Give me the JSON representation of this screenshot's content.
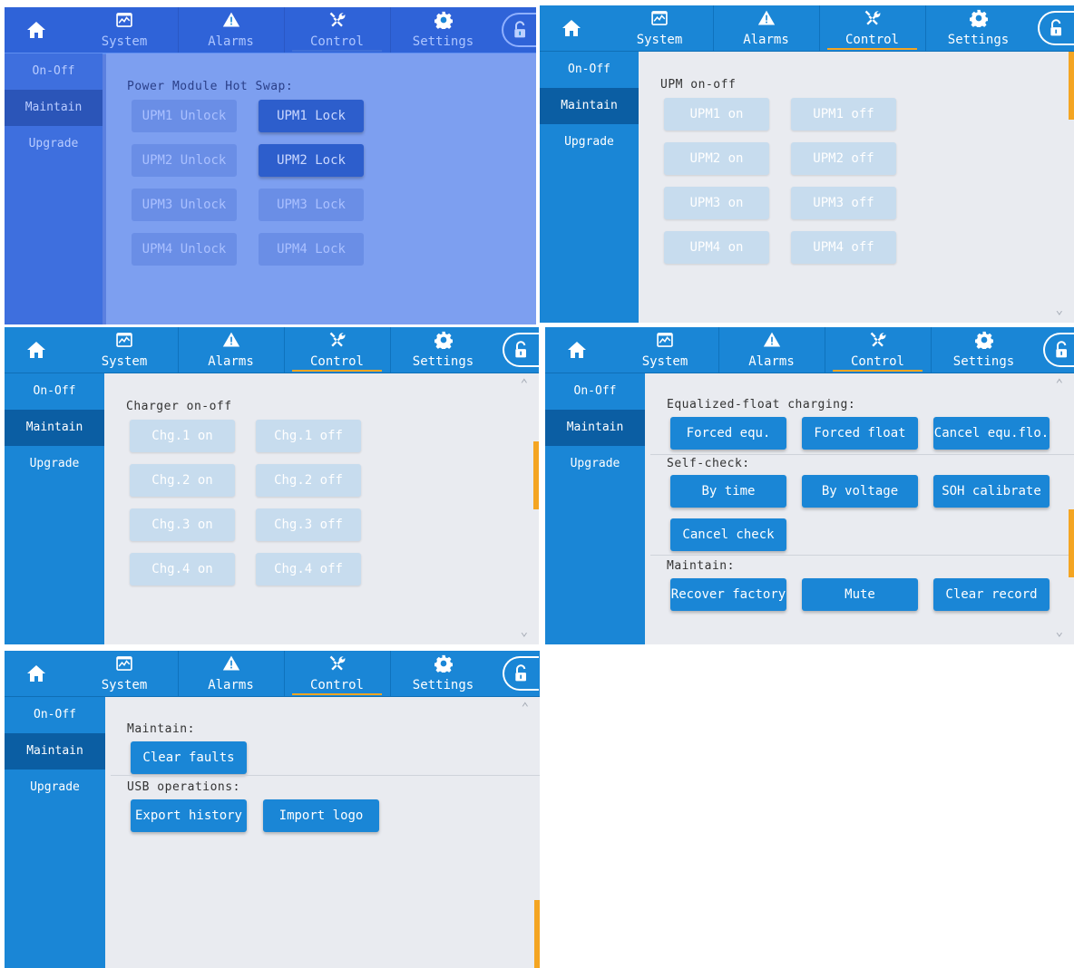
{
  "nav": {
    "tabs": [
      "System",
      "Alarms",
      "Control",
      "Settings"
    ],
    "active_tab": "Control",
    "home_icon": "home-icon",
    "lock_icon": "unlock-icon"
  },
  "sidebar": {
    "items": [
      "On-Off",
      "Maintain",
      "Upgrade"
    ],
    "active": "Maintain"
  },
  "panels": {
    "hot_swap": {
      "section": "Power Module Hot Swap:",
      "buttons": [
        "UPM1 Unlock",
        "UPM1 Lock",
        "UPM2 Unlock",
        "UPM2 Lock",
        "UPM3 Unlock",
        "UPM3 Lock",
        "UPM4 Unlock",
        "UPM4 Lock"
      ]
    },
    "upm": {
      "section": "UPM on-off",
      "buttons": [
        "UPM1 on",
        "UPM1 off",
        "UPM2 on",
        "UPM2 off",
        "UPM3 on",
        "UPM3 off",
        "UPM4 on",
        "UPM4 off"
      ]
    },
    "charger": {
      "section": "Charger on-off",
      "buttons": [
        "Chg.1 on",
        "Chg.1 off",
        "Chg.2 on",
        "Chg.2 off",
        "Chg.3 on",
        "Chg.3 off",
        "Chg.4 on",
        "Chg.4 off"
      ]
    },
    "battery": {
      "section_equ": "Equalized-float charging:",
      "equ_buttons": [
        "Forced equ.",
        "Forced float",
        "Cancel equ.flo."
      ],
      "section_check": "Self-check:",
      "check_buttons": [
        "By time",
        "By voltage",
        "SOH calibrate",
        "Cancel check"
      ],
      "section_maintain": "Maintain:",
      "maintain_buttons": [
        "Recover factory",
        "Mute",
        "Clear record"
      ]
    },
    "usb": {
      "section_maintain": "Maintain:",
      "maintain_buttons": [
        "Clear faults"
      ],
      "section_usb": "USB operations:",
      "usb_buttons": [
        "Export history",
        "Import logo"
      ]
    }
  },
  "colors": {
    "primary": "#1a86d6",
    "sidebar_active": "#0b5ea3",
    "accent": "#f4a522",
    "content_bg": "#e9ebf0",
    "disabled_button": "#c7dcee"
  }
}
